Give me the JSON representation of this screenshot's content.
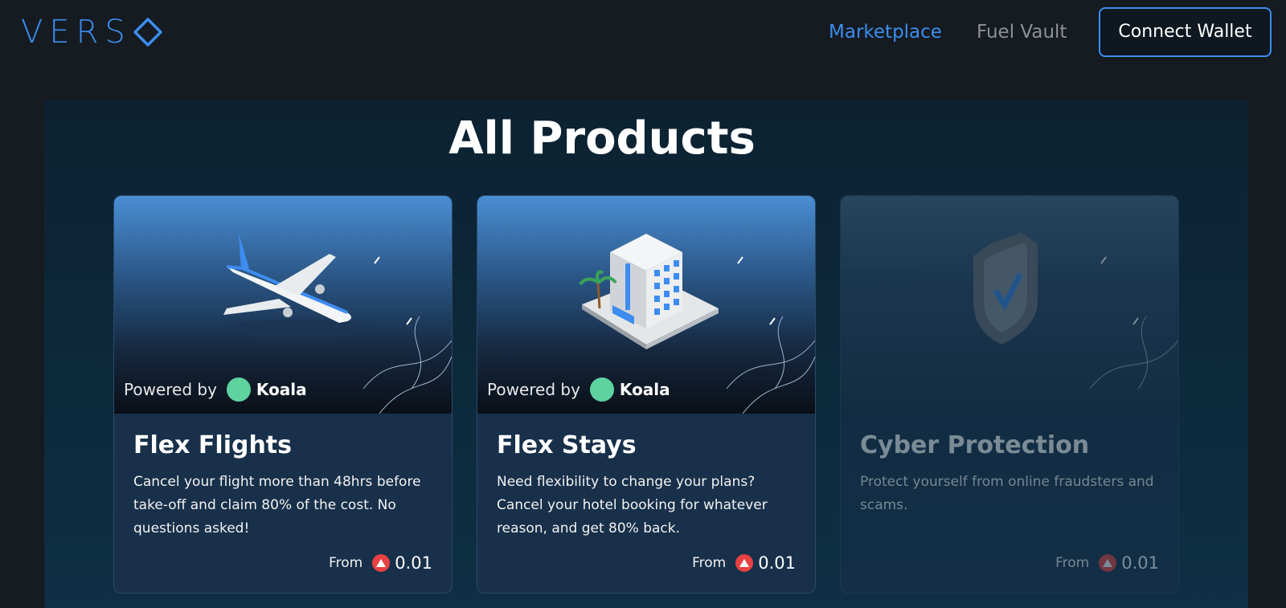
{
  "brand": {
    "name": "VERS"
  },
  "nav": {
    "marketplace": "Marketplace",
    "fuel_vault": "Fuel Vault",
    "connect_wallet": "Connect Wallet"
  },
  "page": {
    "title": "All Products"
  },
  "colors": {
    "accent": "#3d8cf0",
    "background": "#151b20",
    "card": "#18304a",
    "avax": "#e84142",
    "koala": "#5ed3a0"
  },
  "products": [
    {
      "title": "Flex Flights",
      "description": "Cancel your flight more than 48hrs before take-off and claim 80% of the cost. No questions asked!",
      "powered_by": "Powered by",
      "partner": "Koala",
      "price_prefix": "From",
      "price": "0.01",
      "illustration": "airplane-icon",
      "enabled": true
    },
    {
      "title": "Flex Stays",
      "description": "Need flexibility to change your plans? Cancel your hotel booking for whatever reason, and get 80% back.",
      "powered_by": "Powered by",
      "partner": "Koala",
      "price_prefix": "From",
      "price": "0.01",
      "illustration": "hotel-icon",
      "enabled": true
    },
    {
      "title": "Cyber Protection",
      "description": "Protect yourself from online fraudsters and scams.",
      "price_prefix": "From",
      "price": "0.01",
      "illustration": "shield-check-icon",
      "enabled": false
    }
  ]
}
